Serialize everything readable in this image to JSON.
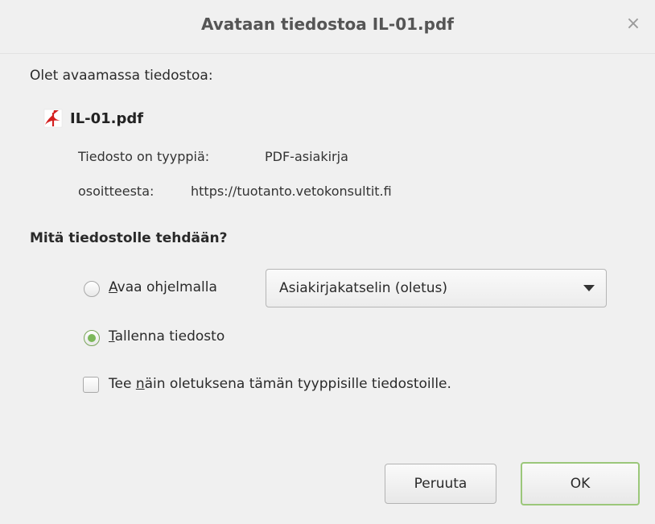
{
  "window": {
    "title": "Avataan tiedostoa IL-01.pdf",
    "close_glyph": "×"
  },
  "intro": "Olet avaamassa tiedostoa:",
  "file": {
    "icon": "pdf-file-icon",
    "name": "IL-01.pdf",
    "type_label": "Tiedosto on tyyppiä:",
    "type_value": "PDF-asiakirja",
    "source_label": "osoitteesta:",
    "source_value": "https://tuotanto.vetokonsultit.fi"
  },
  "question": "Mitä tiedostolle tehdään?",
  "options": {
    "open_with": {
      "label": "Avaa ohjelmalla",
      "selected": false,
      "app": "Asiakirjakatselin (oletus)"
    },
    "save": {
      "label": "Tallenna tiedosto",
      "selected": true
    }
  },
  "default_checkbox": {
    "before": "Tee ",
    "mnemonic": "n",
    "after": "äin oletuksena tämän tyyppisille tiedostoille.",
    "checked": false
  },
  "buttons": {
    "cancel": "Peruuta",
    "ok": "OK"
  },
  "colors": {
    "accent_green": "#7cb85a",
    "pdf_red": "#d42020"
  }
}
